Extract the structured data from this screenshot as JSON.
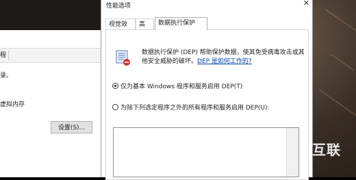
{
  "background_window": {
    "tab_fragment": "程",
    "line_1": "录。",
    "line_2": "虚拟内存",
    "settings_button": "设置(S)..."
  },
  "dialog": {
    "title": "性能选项",
    "close_glyph": "✕",
    "tabs": [
      {
        "label": "视觉效果",
        "active": false
      },
      {
        "label": "高级",
        "active": false
      },
      {
        "label": "数据执行保护",
        "active": true
      }
    ],
    "dep_icon": "shield-page-icon",
    "description": "数据执行保护 (DEP) 帮助保护数据，使其免受病毒攻击或其他安全威胁的破坏。",
    "link": "DEP 是如何工作的?",
    "options": [
      {
        "label": "仅为基本 Windows 程序和服务启用 DEP(T)",
        "checked": true
      },
      {
        "label": "为除下列选定程序之外的所有程序和服务启用 DEP(U):",
        "checked": false
      }
    ]
  },
  "watermark": "互联"
}
